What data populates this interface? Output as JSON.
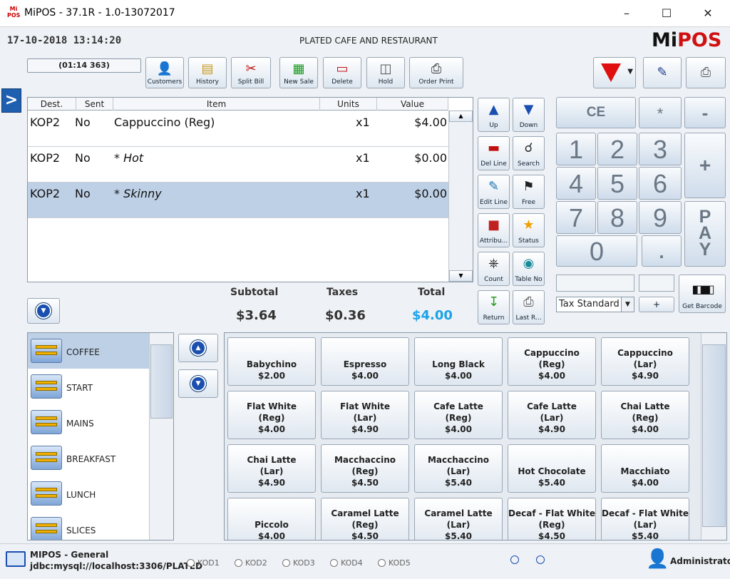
{
  "window": {
    "logo": "Mi POS",
    "title": "MiPOS - 37.1R - 1.0-13072017"
  },
  "header": {
    "datetime": "17-10-2018 13:14:20",
    "restaurant": "PLATED CAFE AND RESTAURANT",
    "brand_mi": "Mi",
    "brand_pos": "POS"
  },
  "timer": "(01:14 363)",
  "toolbar": {
    "customers": "Customers",
    "history": "History",
    "split_bill": "Split Bill",
    "new_sale": "New Sale",
    "delete": "Delete",
    "hold": "Hold",
    "order_print": "Order Print"
  },
  "ticket": {
    "headers": {
      "dest": "Dest.",
      "sent": "Sent",
      "item": "Item",
      "units": "Units",
      "value": "Value"
    },
    "rows": [
      {
        "dest": "KOP2",
        "sent": "No",
        "item": "Cappuccino (Reg)",
        "units": "x1",
        "value": "$4.00"
      },
      {
        "dest": "KOP2",
        "sent": "No",
        "item": "*  Hot",
        "units": "x1",
        "value": "$0.00"
      },
      {
        "dest": "KOP2",
        "sent": "No",
        "item": "*  Skinny",
        "units": "x1",
        "value": "$0.00"
      }
    ]
  },
  "totals": {
    "subtotal_label": "Subtotal",
    "taxes_label": "Taxes",
    "total_label": "Total",
    "subtotal": "$3.64",
    "taxes": "$0.36",
    "total": "$4.00",
    "total_color": "#1aa3e8"
  },
  "actions": {
    "up": "Up",
    "down": "Down",
    "del_line": "Del Line",
    "search": "Search",
    "edit_line": "Edit Line",
    "free": "Free",
    "attributes": "Attribu...",
    "status": "Status",
    "count": "Count",
    "table_no": "Table No",
    "return": "Return",
    "last_receipt": "Last R..."
  },
  "keypad": {
    "ce": "CE",
    "star": "*",
    "minus": "-",
    "plus": "+",
    "dot": ".",
    "pay": "PAY",
    "digits": [
      "1",
      "2",
      "3",
      "4",
      "5",
      "6",
      "7",
      "8",
      "9",
      "0"
    ],
    "small_plus": "+",
    "get_barcode": "Get Barcode",
    "tax_select": "Tax Standard"
  },
  "categories": [
    {
      "name": "COFFEE"
    },
    {
      "name": "START"
    },
    {
      "name": "MAINS"
    },
    {
      "name": "BREAKFAST"
    },
    {
      "name": "LUNCH"
    },
    {
      "name": "SLICES"
    }
  ],
  "products": [
    [
      "Babychino",
      "",
      "$2.00"
    ],
    [
      "Espresso",
      "",
      "$4.00"
    ],
    [
      "Long Black",
      "",
      "$4.00"
    ],
    [
      "Cappuccino",
      "(Reg)",
      "$4.00"
    ],
    [
      "Cappuccino",
      "(Lar)",
      "$4.90"
    ],
    [
      "Flat White",
      "(Reg)",
      "$4.00"
    ],
    [
      "Flat White",
      "(Lar)",
      "$4.90"
    ],
    [
      "Cafe Latte",
      "(Reg)",
      "$4.00"
    ],
    [
      "Cafe Latte",
      "(Lar)",
      "$4.90"
    ],
    [
      "Chai Latte",
      "(Reg)",
      "$4.00"
    ],
    [
      "Chai Latte",
      "(Lar)",
      "$4.90"
    ],
    [
      "Macchaccino",
      "(Reg)",
      "$4.50"
    ],
    [
      "Macchaccino",
      "(Lar)",
      "$5.40"
    ],
    [
      "Hot Chocolate",
      "",
      "$5.40"
    ],
    [
      "Macchiato",
      "",
      "$4.00"
    ],
    [
      "Piccolo",
      "",
      "$4.00"
    ],
    [
      "Caramel Latte",
      "(Reg)",
      "$4.50"
    ],
    [
      "Caramel Latte",
      "(Lar)",
      "$5.40"
    ],
    [
      "Decaf - Flat White",
      "(Reg)",
      "$4.50"
    ],
    [
      "Decaf - Flat White",
      "(Lar)",
      "$5.40"
    ]
  ],
  "status": {
    "app": "MIPOS - General",
    "db": "jdbc:mysql://localhost:3306/PLATED",
    "kods": [
      "KOD1",
      "KOD2",
      "KOD3",
      "KOD4",
      "KOD5"
    ],
    "user": "Administrator"
  }
}
